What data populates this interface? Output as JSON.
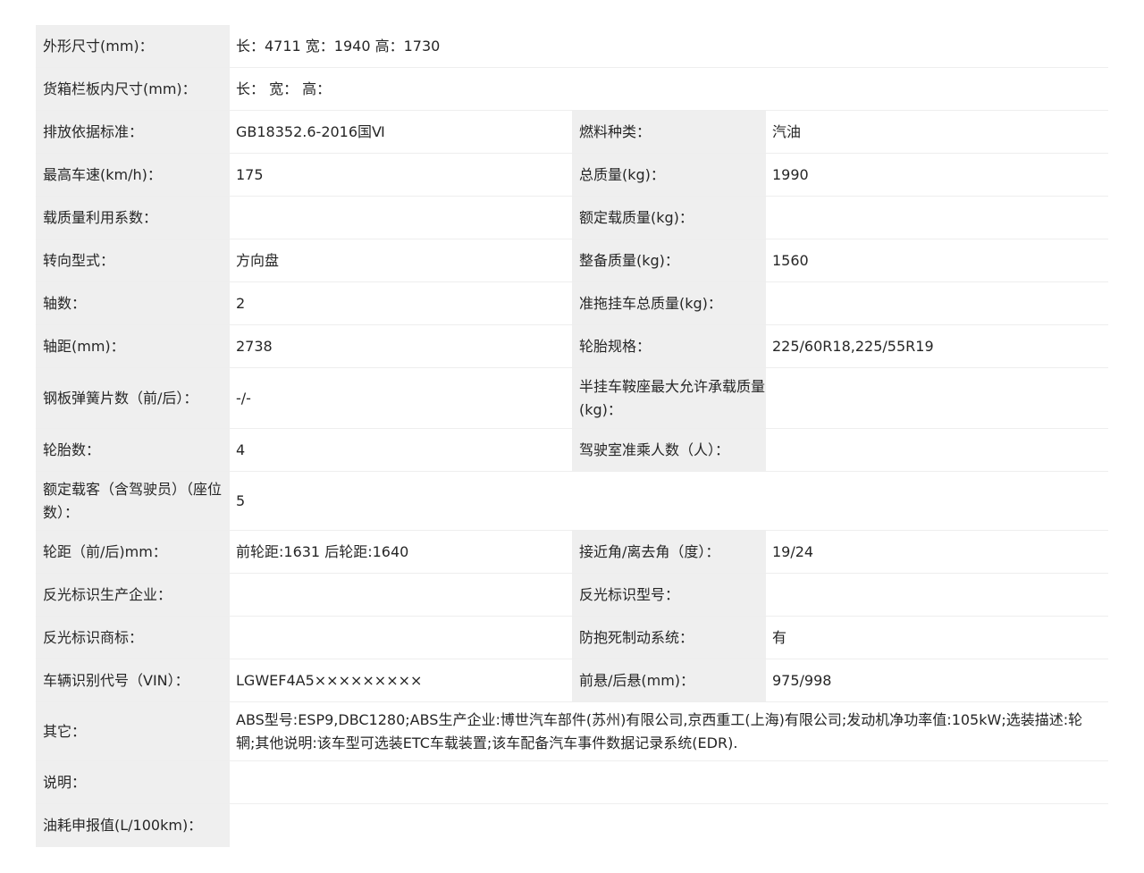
{
  "rows": [
    {
      "type": "wide",
      "label": "外形尺寸(mm)：",
      "value": "长：4711 宽：1940 高：1730"
    },
    {
      "type": "wide",
      "label": "货箱栏板内尺寸(mm)：",
      "value": "长：  宽：  高："
    },
    {
      "type": "pair",
      "label1": "排放依据标准：",
      "value1": "GB18352.6-2016国Ⅵ",
      "label2": "燃料种类：",
      "value2": "汽油"
    },
    {
      "type": "pair",
      "label1": "最高车速(km/h)：",
      "value1": "175",
      "label2": "总质量(kg)：",
      "value2": "1990"
    },
    {
      "type": "pair",
      "label1": "载质量利用系数：",
      "value1": "",
      "label2": "额定载质量(kg)：",
      "value2": ""
    },
    {
      "type": "pair",
      "label1": "转向型式：",
      "value1": "方向盘",
      "label2": "整备质量(kg)：",
      "value2": "1560"
    },
    {
      "type": "pair",
      "label1": "轴数：",
      "value1": "2",
      "label2": "准拖挂车总质量(kg)：",
      "value2": ""
    },
    {
      "type": "pair",
      "label1": "轴距(mm)：",
      "value1": "2738",
      "label2": "轮胎规格：",
      "value2": "225/60R18,225/55R19"
    },
    {
      "type": "pair",
      "label1": "钢板弹簧片数（前/后）：",
      "value1": "-/-",
      "label2": "半挂车鞍座最大允许承载质量(kg)：",
      "value2": ""
    },
    {
      "type": "pair",
      "label1": "轮胎数：",
      "value1": "4",
      "label2": "驾驶室准乘人数（人）：",
      "value2": ""
    },
    {
      "type": "wide",
      "label": "额定载客（含驾驶员）（座位数）：",
      "value": "5"
    },
    {
      "type": "pair",
      "label1": "轮距（前/后)mm：",
      "value1": "前轮距:1631 后轮距:1640",
      "label2": "接近角/离去角（度）：",
      "value2": "19/24"
    },
    {
      "type": "pair",
      "label1": "反光标识生产企业：",
      "value1": "",
      "label2": "反光标识型号：",
      "value2": ""
    },
    {
      "type": "pair",
      "label1": "反光标识商标：",
      "value1": "",
      "label2": "防抱死制动系统：",
      "value2": "有"
    },
    {
      "type": "pair",
      "label1": "车辆识别代号（VIN）：",
      "value1": "LGWEF4A5×××××××××",
      "label2": "前悬/后悬(mm)：",
      "value2": "975/998"
    },
    {
      "type": "wide",
      "label": "其它：",
      "value": "ABS型号:ESP9,DBC1280;ABS生产企业:博世汽车部件(苏州)有限公司,京西重工(上海)有限公司;发动机净功率值:105kW;选装描述:轮辋;其他说明:该车型可选装ETC车载装置;该车配备汽车事件数据记录系统(EDR)."
    },
    {
      "type": "wide",
      "label": "说明：",
      "value": ""
    },
    {
      "type": "wide",
      "label": "油耗申报值(L/100km)：",
      "value": ""
    }
  ]
}
